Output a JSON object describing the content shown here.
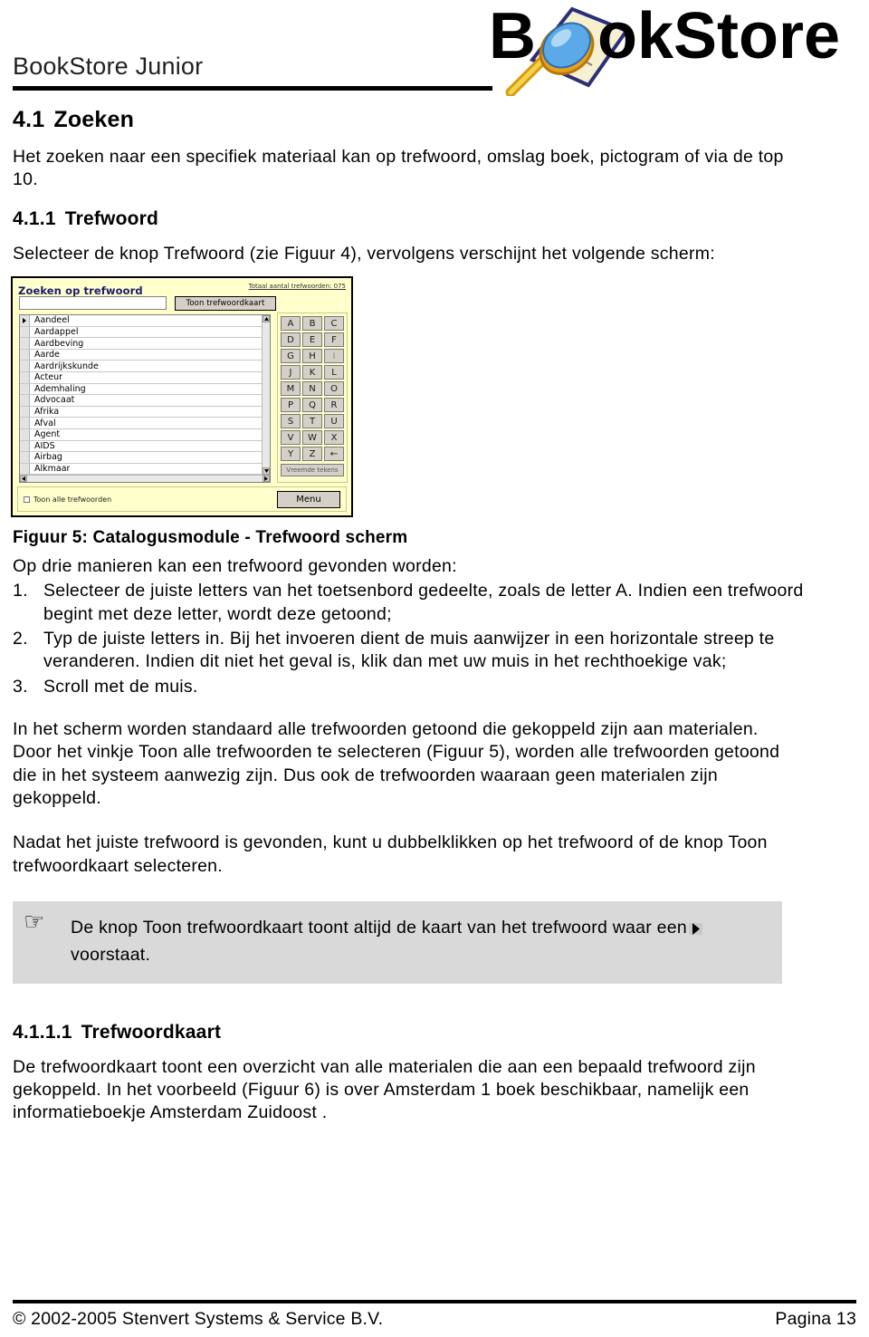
{
  "header": {
    "brand_title": "BookStore Junior",
    "logo_text": "BookStore",
    "logo_icon": "magnifier-over-book-icon"
  },
  "sections": {
    "s1_num": "4.1",
    "s1_title": "Zoeken",
    "s1_para": "Het zoeken naar een specifiek materiaal kan op trefwoord, omslag boek, pictogram of via de top 10.",
    "s2_num": "4.1.1",
    "s2_title": "Trefwoord",
    "s2_para": "Selecteer de knop  Trefwoord  (zie Figuur 4), vervolgens verschijnt het volgende scherm:",
    "s3_num": "4.1.1.1",
    "s3_title": "Trefwoordkaart",
    "s3_para": "De trefwoordkaart toont een overzicht van alle materialen die aan een bepaald trefwoord zijn gekoppeld. In het voorbeeld (Figuur 6) is over Amsterdam 1 boek beschikbaar, namelijk een informatieboekje  Amsterdam Zuidoost ."
  },
  "figure": {
    "caption": "Figuur 5: Catalogusmodule - Trefwoord scherm",
    "app": {
      "title": "Zoeken op trefwoord",
      "total_label": "Totaal aantal trefwoorden: 075",
      "search_value": "",
      "show_card_button": "Toon trefwoordkaart",
      "keywords": [
        "Aandeel",
        "Aardappel",
        "Aardbeving",
        "Aarde",
        "Aardrijkskunde",
        "Acteur",
        "Ademhaling",
        "Advocaat",
        "Afrika",
        "Afval",
        "Agent",
        "AIDS",
        "Airbag",
        "Alkmaar"
      ],
      "selected_keyword": "Aandeel",
      "keypad_keys": [
        "A",
        "B",
        "C",
        "D",
        "E",
        "F",
        "G",
        "H",
        "I",
        "J",
        "K",
        "L",
        "M",
        "N",
        "O",
        "P",
        "Q",
        "R",
        "S",
        "T",
        "U",
        "V",
        "W",
        "X",
        "Y",
        "Z",
        "←"
      ],
      "keypad_special_button": "Vreemde tekens",
      "show_all_checkbox_label": "Toon alle trefwoorden",
      "show_all_checked": false,
      "menu_button": "Menu",
      "panel_color": "#ffffcc",
      "button_color": "#d4d0c8",
      "title_color": "#1a1a6e"
    }
  },
  "three_ways": {
    "intro": "Op drie manieren kan een trefwoord gevonden worden:",
    "steps": [
      {
        "marker": "1.",
        "text": "Selecteer de juiste letters van het toetsenbord gedeelte, zoals de letter A. Indien een trefwoord begint met deze letter, wordt deze getoond;"
      },
      {
        "marker": "2.",
        "text": "Typ de juiste letters in. Bij het invoeren dient de muis aanwijzer in een horizontale streep te veranderen. Indien dit niet het geval is, klik dan met uw muis in het rechthoekige vak;"
      },
      {
        "marker": "3.",
        "text": "Scroll met de muis."
      }
    ]
  },
  "paragraphs": {
    "p_standaard": "In het scherm worden standaard alle trefwoorden getoond die gekoppeld zijn aan materialen. Door het vinkje  Toon alle trefwoorden  te selecteren (Figuur 5), worden alle trefwoorden getoond die in het systeem aanwezig zijn. Dus ook de trefwoorden waaraan geen materialen zijn gekoppeld.",
    "p_nadat": "Nadat het juiste trefwoord is gevonden, kunt u dubbelklikken op het trefwoord of de knop  Toon trefwoordkaart  selecteren."
  },
  "callout": {
    "icon": "pointing-hand-icon",
    "icon_glyph": "☞",
    "text_before": "De knop  Toon trefwoordkaart  toont altijd de kaart van het trefwoord waar een",
    "text_after": "voorstaat.",
    "marker_icon": "right-triangle-icon",
    "background": "#d9d9d9"
  },
  "footer": {
    "copyright": "© 2002-2005 Stenvert Systems & Service B.V.",
    "page": "Pagina 13"
  }
}
